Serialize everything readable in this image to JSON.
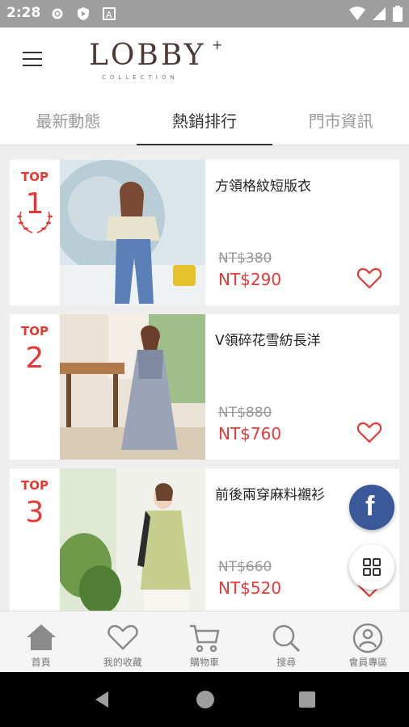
{
  "status_bar": {
    "time": "2:28"
  },
  "header": {
    "logo_main": "LOBBY",
    "logo_plus": "+",
    "logo_sub": "COLLECTION"
  },
  "tabs": [
    {
      "label": "最新動態",
      "active": false
    },
    {
      "label": "熱銷排行",
      "active": true
    },
    {
      "label": "門市資訊",
      "active": false
    }
  ],
  "products": [
    {
      "rank_tag": "TOP",
      "rank": "1",
      "name": "方領格紋短版衣",
      "original_price": "NT$380",
      "price": "NT$290"
    },
    {
      "rank_tag": "TOP",
      "rank": "2",
      "name": "V領碎花雪紡長洋",
      "original_price": "NT$880",
      "price": "NT$760"
    },
    {
      "rank_tag": "TOP",
      "rank": "3",
      "name": "前後兩穿麻料襯衫",
      "original_price": "NT$660",
      "price": "NT$520"
    }
  ],
  "floating": {
    "facebook_label": "f"
  },
  "bottom_nav": [
    {
      "label": "首頁",
      "icon": "home-icon"
    },
    {
      "label": "我的收藏",
      "icon": "heart-icon"
    },
    {
      "label": "購物車",
      "icon": "cart-icon"
    },
    {
      "label": "搜尋",
      "icon": "search-icon"
    },
    {
      "label": "會員專區",
      "icon": "user-icon"
    }
  ],
  "colors": {
    "accent": "#e53935",
    "facebook": "#3b5998",
    "status_bar": "#9e9e9e"
  }
}
